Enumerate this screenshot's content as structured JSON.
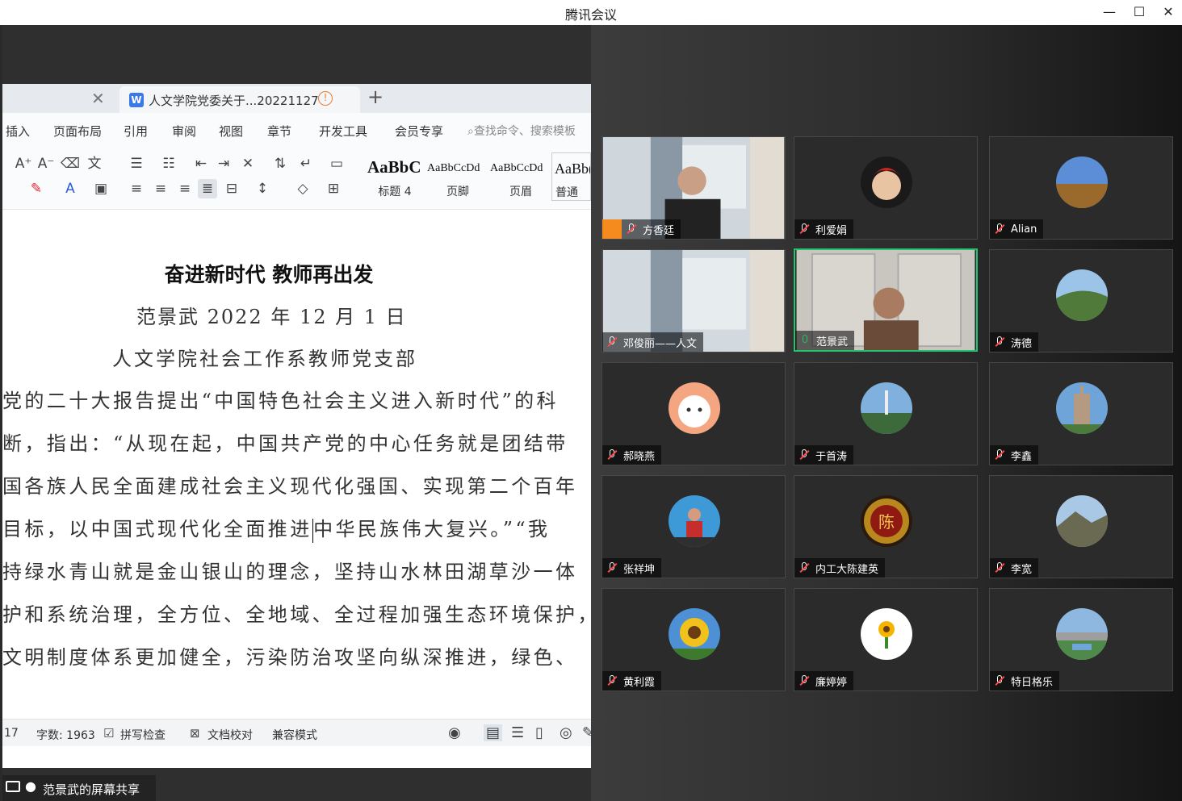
{
  "window": {
    "title": "腾讯会议",
    "minimize": "—",
    "maximize": "☐",
    "close": "✕"
  },
  "wps": {
    "tab_close": "✕",
    "tab_icon": "W",
    "tab_name": "人文学院党委关于...20221127",
    "tab_warn": "!",
    "tab_add": "+",
    "menu": [
      "插入",
      "页面布局",
      "引用",
      "审阅",
      "视图",
      "章节",
      "开发工具",
      "会员专享"
    ],
    "search_placeholder": "查找命令、搜索模板",
    "styles": [
      {
        "sample": "AaBbC",
        "label": "标题 4"
      },
      {
        "sample": "AaBbCcDd",
        "label": "页脚"
      },
      {
        "sample": "AaBbCcDd",
        "label": "页眉"
      },
      {
        "sample": "AaBb(",
        "label": "普通(网"
      }
    ],
    "doc": {
      "title": "奋进新时代  教师再出发",
      "byline": "范景武    2022 年 12 月 1 日",
      "org": "人文学院社会工作系教师党支部",
      "lines": [
        "党的二十大报告提出“中国特色社会主义进入新时代”的科",
        "断，指出：“从现在起，中国共产党的中心任务就是团结带",
        "国各族人民全面建成社会主义现代化强国、实现第二个百年",
        "目标，以中国式现代化全面推进",
        "中华民族伟大复兴。”“我",
        "持绿水青山就是金山银山的理念，坚持山水林田湖草沙一体",
        "护和系统治理，全方位、全地域、全过程加强生态环境保护，",
        "文明制度体系更加健全，污染防治攻坚向纵深推进，绿色、"
      ]
    },
    "status": {
      "page": "17",
      "word_count": "字数: 1963",
      "spell_check": "拼写检查",
      "doc_proof": "文档校对",
      "compat": "兼容模式"
    }
  },
  "share_footer": {
    "label": "范景武的屏幕共享"
  },
  "participants": [
    {
      "name": "方香廷",
      "type": "video",
      "muted": true,
      "host": true
    },
    {
      "name": "利爱娟",
      "type": "avatar",
      "muted": true
    },
    {
      "name": "Alian",
      "type": "avatar",
      "muted": true
    },
    {
      "name": "邓俊丽——人文",
      "type": "video",
      "muted": true
    },
    {
      "name": "范景武",
      "type": "video",
      "muted": false,
      "active": true
    },
    {
      "name": "涛德",
      "type": "avatar",
      "muted": true
    },
    {
      "name": "郝晓燕",
      "type": "avatar",
      "muted": true
    },
    {
      "name": "于首涛",
      "type": "avatar",
      "muted": true
    },
    {
      "name": "李鑫",
      "type": "avatar",
      "muted": true
    },
    {
      "name": "张祥坤",
      "type": "avatar",
      "muted": true
    },
    {
      "name": "内工大陈建英",
      "type": "avatar",
      "muted": true
    },
    {
      "name": "李宽",
      "type": "avatar",
      "muted": true
    },
    {
      "name": "黄利霞",
      "type": "avatar",
      "muted": true
    },
    {
      "name": "廉婷婷",
      "type": "avatar",
      "muted": true
    },
    {
      "name": "特日格乐",
      "type": "avatar",
      "muted": true
    }
  ],
  "colors": {
    "active_speaker": "#21c56c",
    "host_badge": "#f58a1f",
    "muted_slash": "#ff4b4b",
    "wps_blue": "#3a79e8"
  }
}
